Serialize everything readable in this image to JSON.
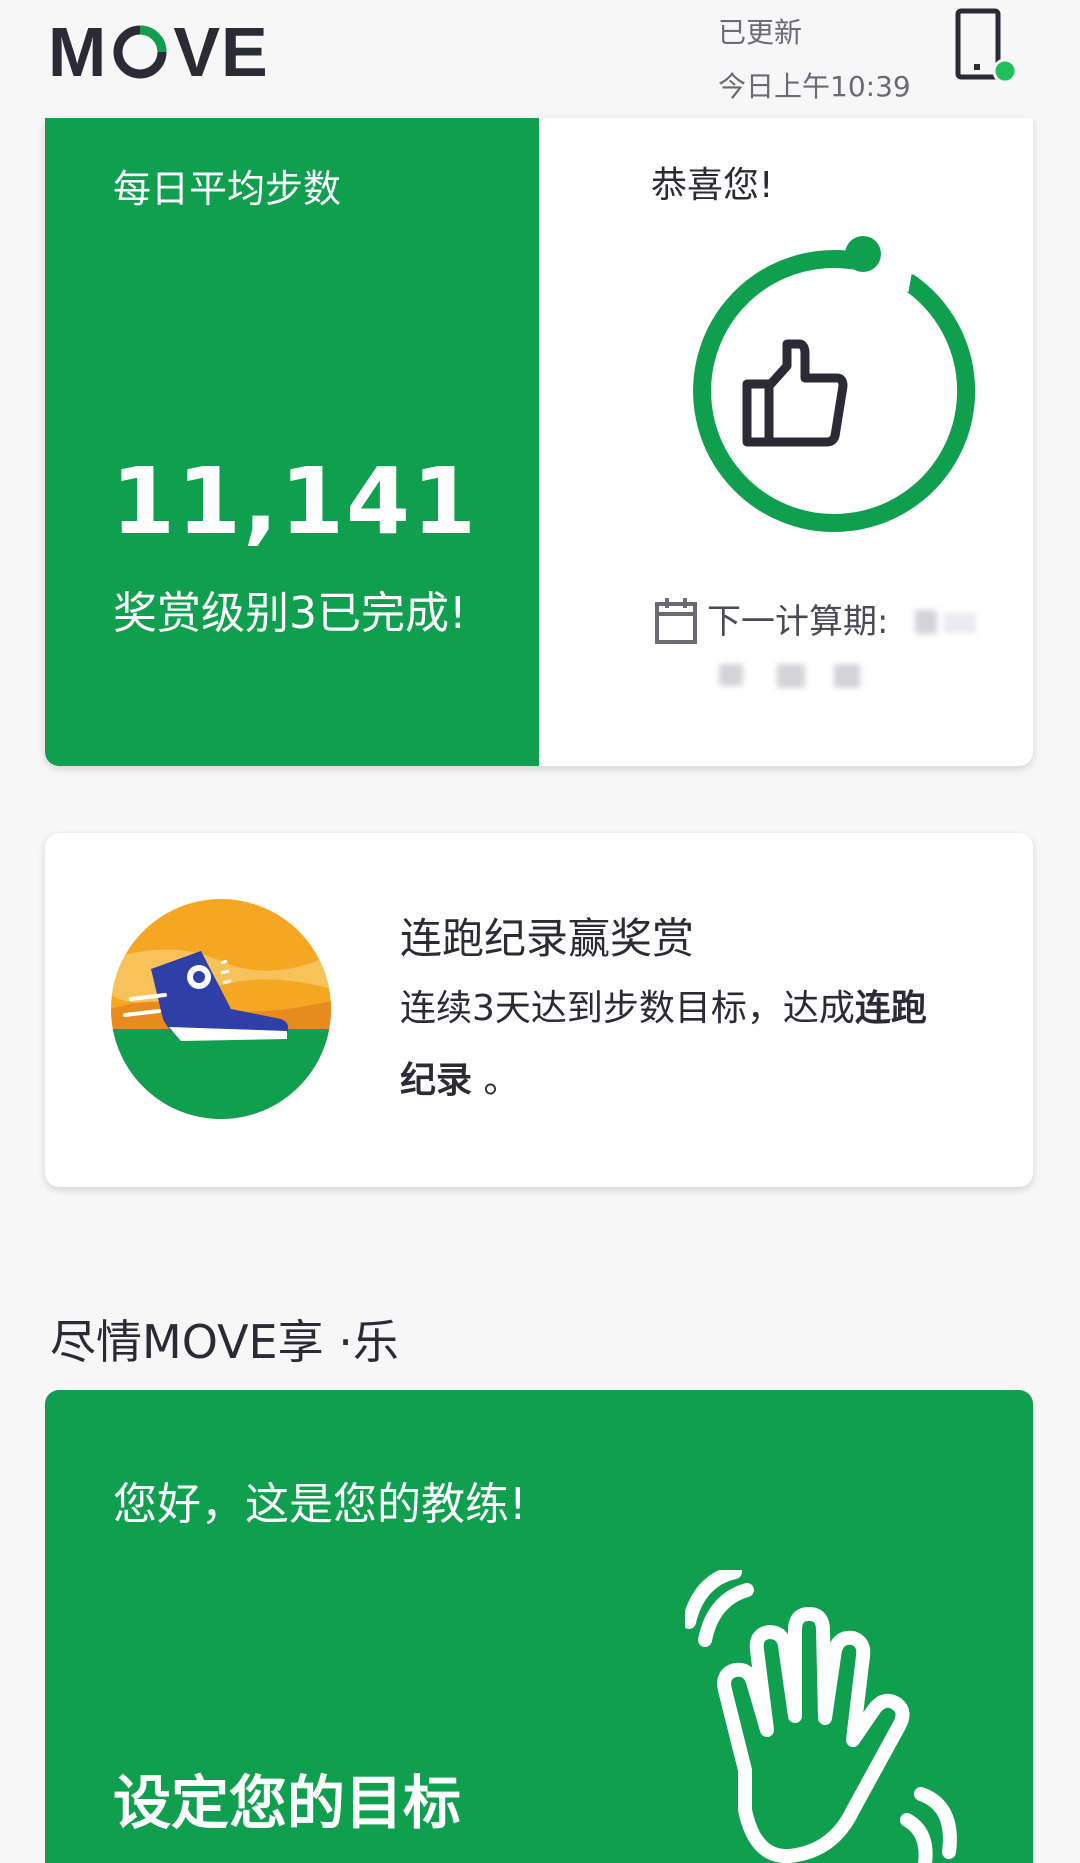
{
  "header": {
    "logo": {
      "text_before": "M",
      "text_after": "VE"
    },
    "sync_status": "已更新",
    "sync_time": "今日上午10:39"
  },
  "steps_card": {
    "label": "每日平均步数",
    "value": "11,141",
    "status": "奖赏级别3已完成!",
    "congrats": "恭喜您!",
    "next_period_label": "下一计算期:"
  },
  "streak_card": {
    "title": "连跑纪录赢奖赏",
    "desc_prefix": "连续3天达到步数目标，达成",
    "desc_bold": "连跑纪录",
    "desc_suffix": " 。"
  },
  "section_title": "尽情MOVE享 ·乐",
  "coach_card": {
    "greeting": "您好，这是您的教练!",
    "cta": "设定您的目标"
  },
  "colors": {
    "brand_green": "#0f9f4f",
    "dark_green": "#10804a",
    "text_dark": "#2b2b36"
  },
  "icons": [
    "move-logo-ring-icon",
    "device-sync-icon",
    "thumbs-up-icon",
    "calendar-icon",
    "running-shoe-icon",
    "waving-hand-icon"
  ]
}
